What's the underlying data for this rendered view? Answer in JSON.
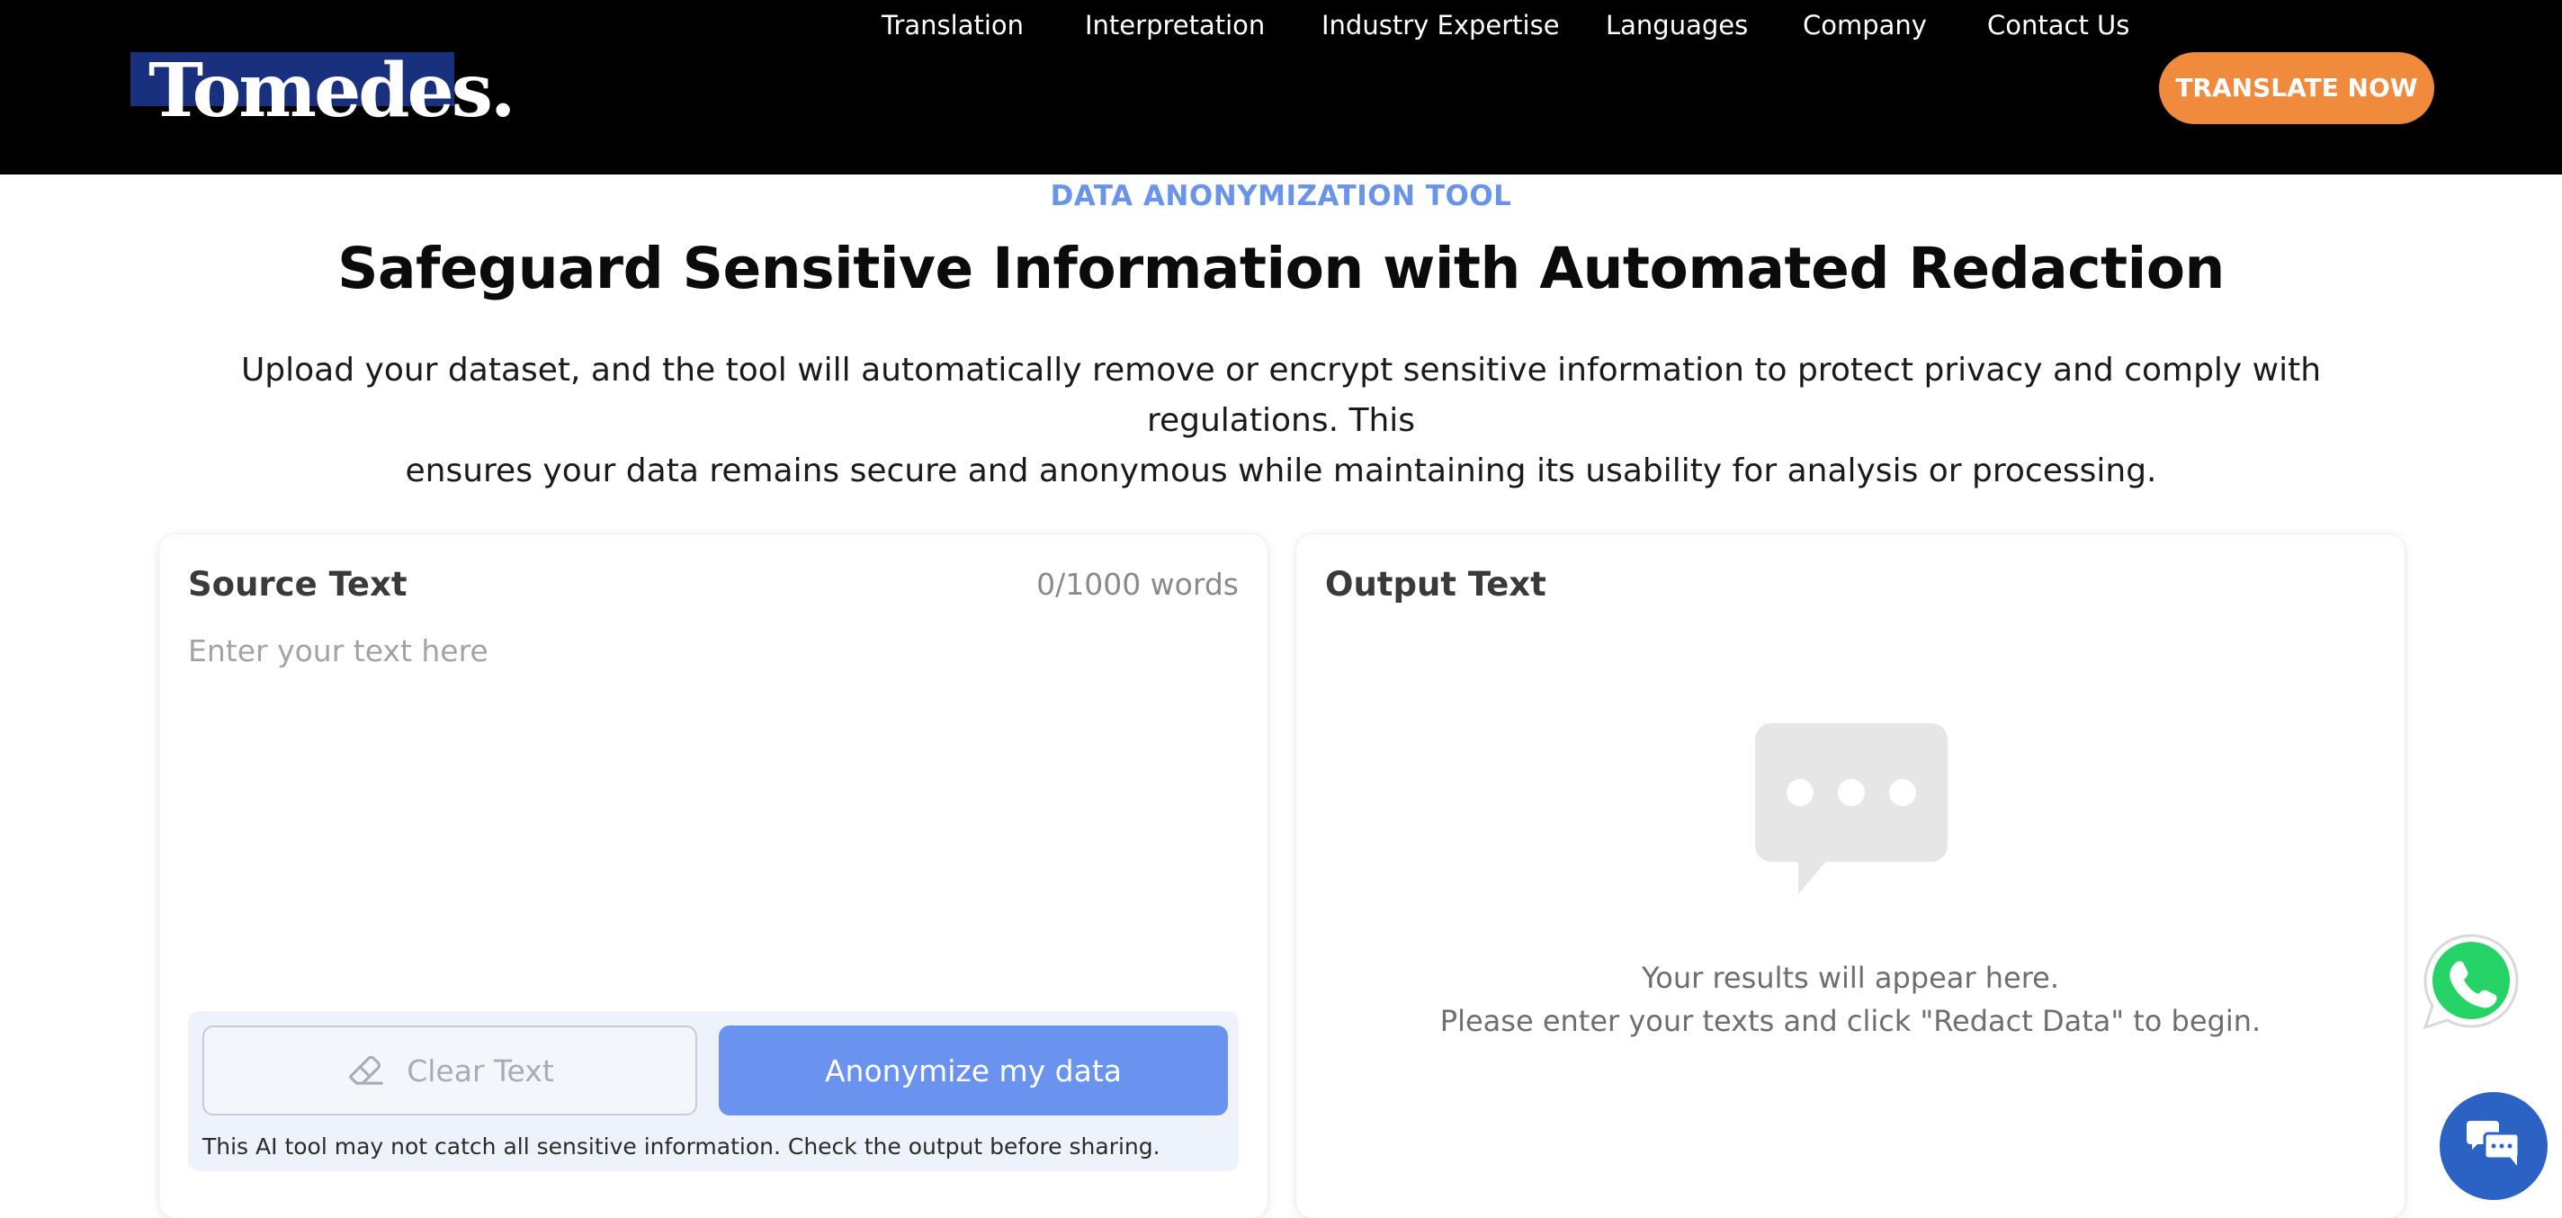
{
  "header": {
    "logo_text": "Tomedes.",
    "nav": [
      "Translation",
      "Interpretation",
      "Industry Expertise",
      "Languages",
      "Company",
      "Contact Us"
    ],
    "cta_label": "TRANSLATE NOW"
  },
  "hero": {
    "eyebrow": "DATA ANONYMIZATION TOOL",
    "title": "Safeguard Sensitive Information with Automated Redaction",
    "subtitle_line1": "Upload your dataset, and the tool will automatically remove or encrypt sensitive information to protect privacy and comply with regulations. This",
    "subtitle_line2": "ensures your data remains secure and anonymous while maintaining its usability for analysis or processing."
  },
  "source": {
    "title": "Source Text",
    "word_count": "0/1000 words",
    "placeholder": "Enter your text here",
    "clear_label": "Clear Text",
    "anonymize_label": "Anonymize my data",
    "disclaimer": "This AI tool may not catch all sensitive information. Check the output before sharing."
  },
  "output": {
    "title": "Output Text",
    "empty_line1": "Your results will appear here.",
    "empty_line2": "Please enter your texts and click \"Redact Data\" to begin."
  },
  "colors": {
    "accent_blue": "#6a93f0",
    "cta_orange": "#f08a3c",
    "logo_blue": "#19307f",
    "chat_blue": "#2c62c4",
    "whatsapp_green": "#25d366"
  },
  "icons": {
    "clear": "eraser-icon",
    "output_placeholder": "chat-bubble-icon",
    "whatsapp": "whatsapp-icon",
    "chat": "live-chat-icon"
  }
}
